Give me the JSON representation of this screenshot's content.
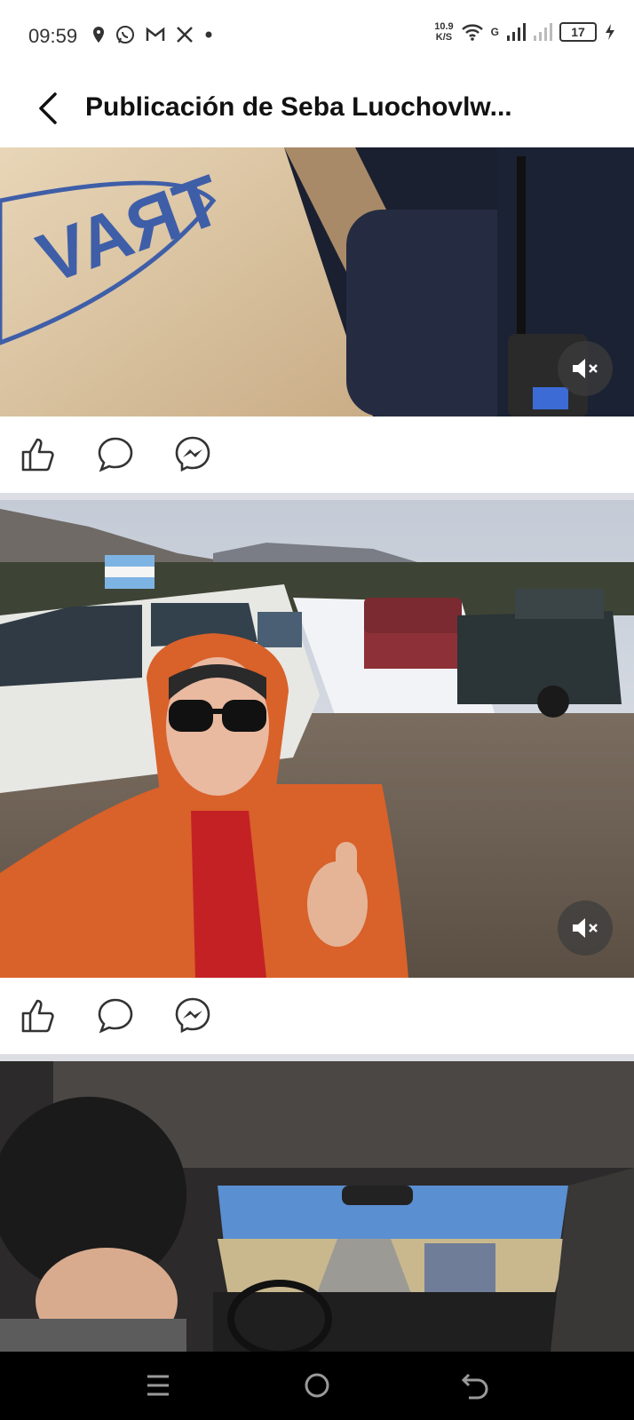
{
  "status_bar": {
    "time": "09:59",
    "speed_value": "10.9",
    "speed_unit": "K/S",
    "network": "G",
    "battery": "17"
  },
  "header": {
    "title": "Publicación de Seba Luochovlw..."
  },
  "posts": [
    {
      "icons": [
        "like-icon",
        "comment-icon",
        "messenger-icon"
      ],
      "video_muted": true
    },
    {
      "icons": [
        "like-icon",
        "comment-icon",
        "messenger-icon"
      ],
      "video_muted": true
    }
  ],
  "nav": {
    "icons": [
      "menu-icon",
      "home-icon",
      "back-icon"
    ]
  }
}
